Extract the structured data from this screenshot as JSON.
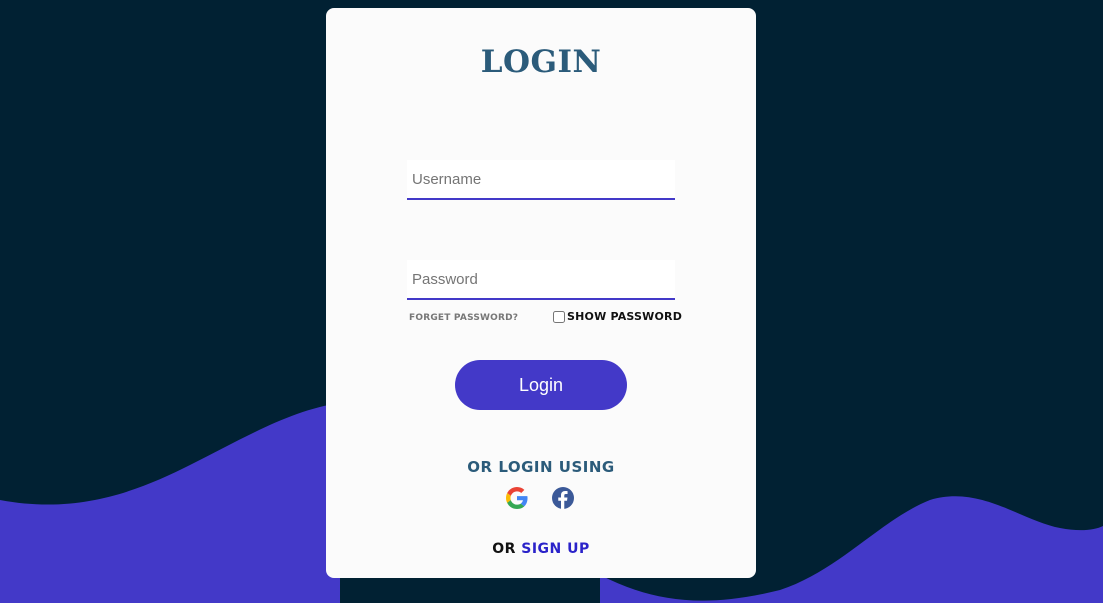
{
  "login": {
    "title": "LOGIN",
    "username_placeholder": "Username",
    "password_placeholder": "Password",
    "forgot_password": "FORGET PASSWORD?",
    "show_password": "SHOW PASSWORD",
    "login_button": "Login",
    "or_login_using": "OR LOGIN USING",
    "or_text": "OR",
    "sign_up": "SIGN UP"
  },
  "social": [
    "google-icon",
    "facebook-icon"
  ],
  "colors": {
    "background": "#012133",
    "wave": "#4339c8",
    "card": "#fbfbfb",
    "accent": "#4339c8",
    "title": "#2b5b7a",
    "signup_link": "#2a22c9"
  }
}
